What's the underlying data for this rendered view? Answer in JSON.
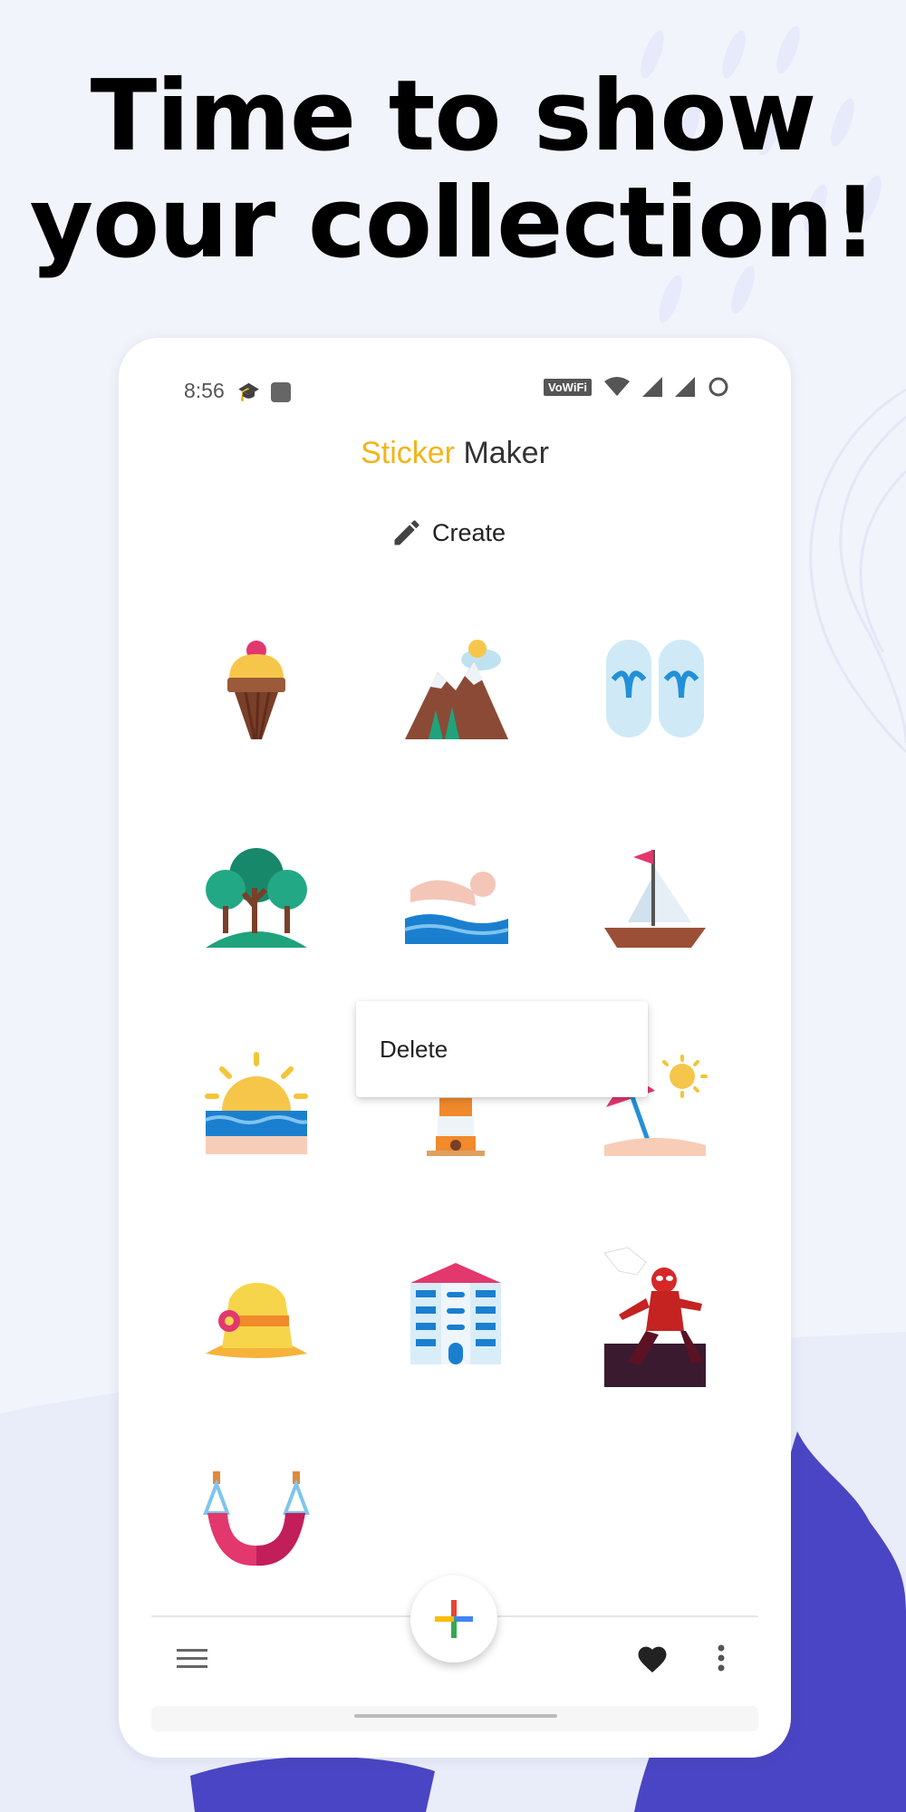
{
  "headline": {
    "line1": "Time to show",
    "line2": "your collection!"
  },
  "status_bar": {
    "time": "8:56",
    "network_label": "VoWiFi"
  },
  "app_bar": {
    "title_part1": "Sticker",
    "title_part2": "Maker"
  },
  "create_action": {
    "label": "Create"
  },
  "stickers": [
    "ice-cream",
    "mountains",
    "flip-flops",
    "trees",
    "swimmer",
    "sailboat",
    "sunset-sea",
    "lighthouse",
    "beach-umbrella",
    "sun-hat",
    "building",
    "spider-hero",
    "hammock"
  ],
  "context_menu": {
    "delete_label": "Delete"
  },
  "bottom_bar": {
    "menu_icon": "hamburger-icon",
    "fab_icon": "plus-icon",
    "favorite_icon": "heart-icon",
    "more_icon": "more-vert-icon"
  },
  "colors": {
    "brand_yellow": "#f2b418",
    "background": "#f2f4fb",
    "blob_purple": "#4a45c4"
  }
}
